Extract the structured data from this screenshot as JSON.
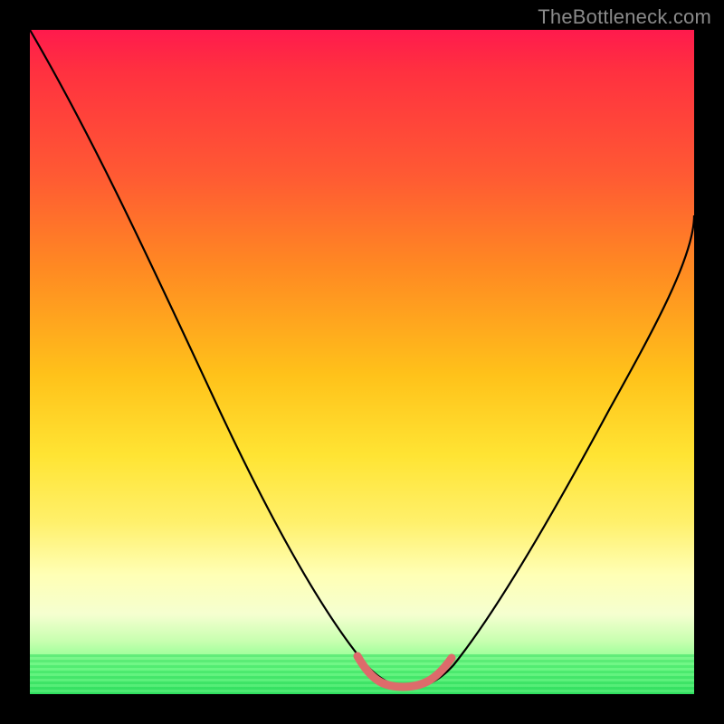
{
  "watermark": "TheBottleneck.com",
  "chart_data": {
    "type": "line",
    "title": "",
    "xlabel": "",
    "ylabel": "",
    "xlim": [
      0,
      100
    ],
    "ylim": [
      0,
      100
    ],
    "grid": false,
    "legend": false,
    "series": [
      {
        "name": "bottleneck-curve",
        "x": [
          0,
          8,
          16,
          24,
          32,
          40,
          47,
          51,
          55,
          58,
          60,
          62,
          66,
          72,
          80,
          90,
          100
        ],
        "values": [
          100,
          87,
          73,
          58,
          43,
          28,
          14,
          4,
          1,
          1,
          1,
          3,
          10,
          22,
          38,
          55,
          72
        ]
      }
    ],
    "annotations": [
      {
        "name": "optimal-region",
        "x_start": 50,
        "x_end": 62,
        "note": "red highlighted valley segment"
      }
    ],
    "colors": {
      "curve": "#000000",
      "curve_highlight": "#e06a6a",
      "gradient_top": "#ff1a4d",
      "gradient_bottom": "#30e060",
      "frame": "#000000"
    }
  }
}
